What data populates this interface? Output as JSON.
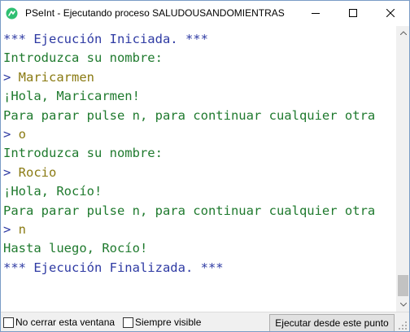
{
  "window": {
    "title": "PSeInt - Ejecutando proceso SALUDOUSANDOMIENTRAS",
    "icon": "pseint-logo-icon",
    "accent_color": "#2fbf71"
  },
  "titlebar_buttons": {
    "minimize": "minimize-icon",
    "maximize": "maximize-icon",
    "close": "close-icon"
  },
  "colors": {
    "system_text": "#2e3aa3",
    "output_text": "#1f7a2e",
    "input_text": "#8a7a12"
  },
  "console": {
    "lines": [
      {
        "kind": "sys",
        "text": "*** Ejecución Iniciada. ***"
      },
      {
        "kind": "out",
        "text": "Introduzca su nombre:"
      },
      {
        "kind": "in",
        "prompt": "> ",
        "text": "Maricarmen"
      },
      {
        "kind": "out",
        "text": "¡Hola, Maricarmen!"
      },
      {
        "kind": "out",
        "text": "Para parar pulse n, para continuar cualquier otra"
      },
      {
        "kind": "in",
        "prompt": "> ",
        "text": "o"
      },
      {
        "kind": "out",
        "text": "Introduzca su nombre:"
      },
      {
        "kind": "in",
        "prompt": "> ",
        "text": "Rocio"
      },
      {
        "kind": "out",
        "text": "¡Hola, Rocío!"
      },
      {
        "kind": "out",
        "text": "Para parar pulse n, para continuar cualquier otra"
      },
      {
        "kind": "in",
        "prompt": "> ",
        "text": "n"
      },
      {
        "kind": "out",
        "text": "Hasta luego, Rocío!"
      },
      {
        "kind": "sys",
        "text": "*** Ejecución Finalizada. ***"
      }
    ]
  },
  "bottom": {
    "checkbox1_label": "No cerrar esta ventana",
    "checkbox1_checked": false,
    "checkbox2_label": "Siempre visible",
    "checkbox2_checked": false,
    "run_button_label": "Ejecutar desde este punto"
  }
}
